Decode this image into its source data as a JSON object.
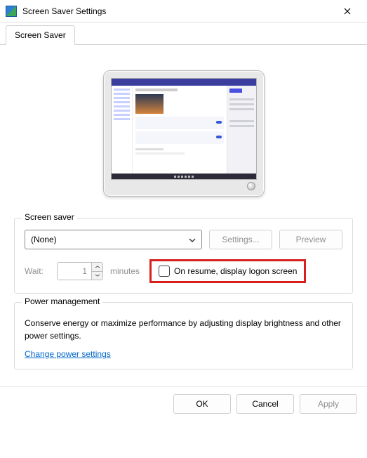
{
  "title": "Screen Saver Settings",
  "tab": {
    "label": "Screen Saver"
  },
  "screen_saver": {
    "group_label": "Screen saver",
    "selected": "(None)",
    "settings_button": "Settings...",
    "preview_button": "Preview",
    "wait_label": "Wait:",
    "wait_value": "1",
    "minutes_label": "minutes",
    "on_resume_label": "On resume, display logon screen"
  },
  "power": {
    "group_label": "Power management",
    "description": "Conserve energy or maximize performance by adjusting display brightness and other power settings.",
    "link": "Change power settings"
  },
  "buttons": {
    "ok": "OK",
    "cancel": "Cancel",
    "apply": "Apply"
  }
}
